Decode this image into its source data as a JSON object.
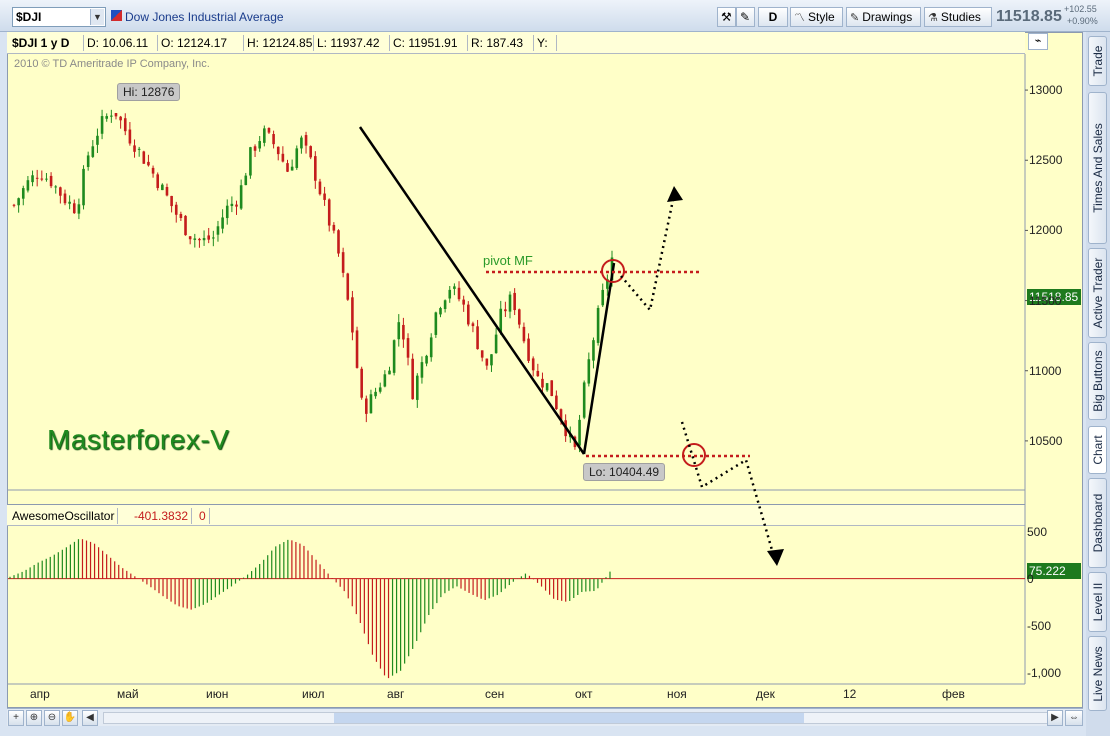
{
  "toolbar": {
    "symbol": "$DJI",
    "name": "Dow Jones Industrial Average",
    "aggregation": "D",
    "style_label": "Style",
    "drawings_label": "Drawings",
    "studies_label": "Studies",
    "last_price": "11518.85",
    "change": "+102.55",
    "change_pct": "+0.90%"
  },
  "info_bar": {
    "symbol": "$DJI 1 y D",
    "date": "D: 10.06.11",
    "open": "O: 12124.17",
    "high": "H: 12124.85",
    "low": "L: 11937.42",
    "close": "C: 11951.91",
    "range": "R: 187.43",
    "y": "Y:"
  },
  "copyright": "2010 © TD Ameritrade IP Company, Inc.",
  "annotations": {
    "hi_label": "Hi: 12876",
    "lo_label": "Lo: 10404.49",
    "pivot_label": "pivot MF",
    "watermark": "Masterforex-V",
    "price_tag": "11518.85",
    "osc_tag": "75.222"
  },
  "oscillator": {
    "name": "AwesomeOscillator",
    "value": "-401.3832",
    "extra": "0"
  },
  "side_tabs": [
    "Trade",
    "Times And Sales",
    "Active Trader",
    "Big Buttons",
    "Chart",
    "Dashboard",
    "Level II",
    "Live News"
  ],
  "colors": {
    "up": "#1e8a1e",
    "down": "#c41c1c",
    "background": "#ffffc8",
    "pivot": "#c41c1c"
  },
  "chart_data": [
    {
      "type": "candlestick",
      "title": "$DJI 1 y D",
      "x": [
        "апр",
        "май",
        "июн",
        "июл",
        "авг",
        "сен",
        "окт",
        "ноя",
        "дек",
        "12",
        "фев"
      ],
      "y_ticks": [
        13000,
        12500,
        12000,
        11500,
        11000,
        10500
      ],
      "ylim": [
        10150,
        13250
      ],
      "key_points": {
        "high": 12876,
        "low": 10404.49,
        "last": 11518.85,
        "pivot": 11730
      },
      "close_path": [
        12180,
        12330,
        12420,
        12350,
        12230,
        12150,
        12560,
        12760,
        12870,
        12700,
        12570,
        12430,
        12280,
        12120,
        11980,
        11920,
        11950,
        12150,
        12230,
        12550,
        12700,
        12600,
        12420,
        12650,
        12450,
        12150,
        11850,
        11400,
        10700,
        10850,
        11000,
        11400,
        10850,
        11120,
        11460,
        11600,
        11480,
        11250,
        11000,
        11380,
        11530,
        11200,
        10950,
        10880,
        10650,
        10420,
        11000,
        11450,
        11800
      ]
    },
    {
      "type": "bar",
      "title": "AwesomeOscillator",
      "y_ticks": [
        500,
        0,
        -500,
        -1000
      ],
      "ylim": [
        -1100,
        550
      ],
      "values": [
        20,
        80,
        170,
        240,
        330,
        430,
        380,
        250,
        120,
        20,
        -80,
        -190,
        -290,
        -330,
        -270,
        -170,
        -70,
        40,
        170,
        340,
        420,
        360,
        190,
        20,
        -140,
        -430,
        -820,
        -1070,
        -980,
        -710,
        -390,
        -170,
        -80,
        -160,
        -230,
        -170,
        -40,
        60,
        -70,
        -220,
        -250,
        -140,
        -130,
        75
      ]
    }
  ]
}
